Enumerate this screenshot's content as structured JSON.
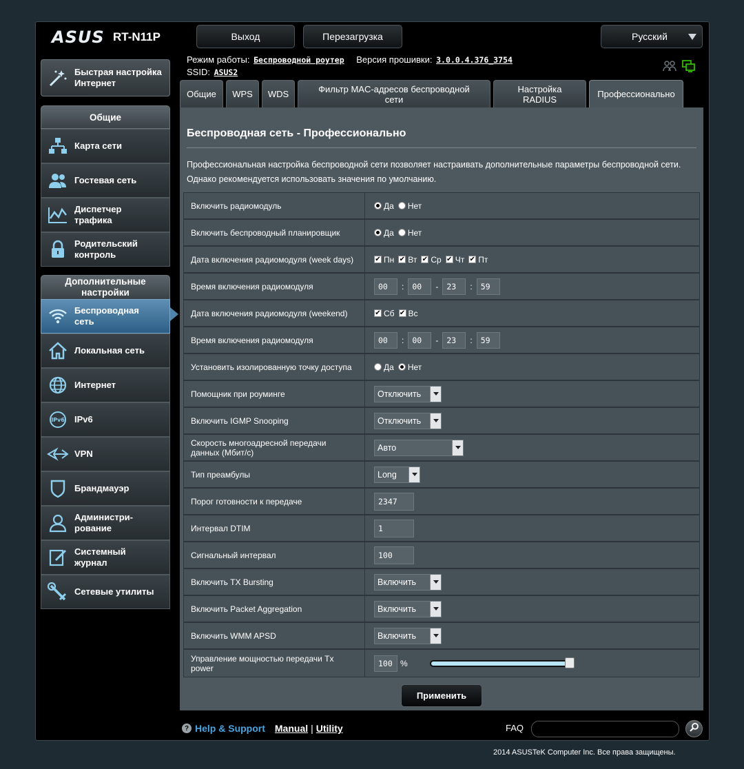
{
  "header": {
    "logo_text": "ASUS",
    "model": "RT-N11P",
    "logout_label": "Выход",
    "reboot_label": "Перезагрузка",
    "language": "Русский"
  },
  "info": {
    "mode_label": "Режим работы:",
    "mode_value": "Беспроводной роутер",
    "firmware_label": "Версия прошивки:",
    "firmware_value": "3.0.0.4.376_3754",
    "ssid_label": "SSID:",
    "ssid_value": "ASUS2"
  },
  "sidebar": {
    "quick_setup": [
      "Быстрая настройка",
      "Интернет"
    ],
    "general_header": "Общие",
    "general_items": [
      {
        "label": "Карта сети"
      },
      {
        "label": "Гостевая сеть"
      },
      {
        "label1": "Диспетчер",
        "label2": "трафика"
      },
      {
        "label1": "Родительский",
        "label2": "контроль"
      }
    ],
    "advanced_header1": "Дополнительные",
    "advanced_header2": "настройки",
    "advanced_items": [
      {
        "label1": "Беспроводная",
        "label2": "сеть"
      },
      {
        "label": "Локальная сеть"
      },
      {
        "label": "Интернет"
      },
      {
        "label": "IPv6"
      },
      {
        "label": "VPN"
      },
      {
        "label": "Брандмауэр"
      },
      {
        "label1": "Администри-",
        "label2": "рование"
      },
      {
        "label1": "Системный",
        "label2": "журнал"
      },
      {
        "label": "Сетевые утилиты"
      }
    ]
  },
  "tabs": {
    "general": "Общие",
    "wps": "WPS",
    "wds": "WDS",
    "mac_filter": "Фильтр MAC-адресов беспроводной сети",
    "radius1": "Настройка",
    "radius2": "RADIUS",
    "professional": "Профессионально"
  },
  "page": {
    "title": "Беспроводная сеть - Профессионально",
    "desc1": "Профессиональная настройка беспроводной сети позволяет настраивать дополнительные параметры беспроводной сети.",
    "desc2": "Однако рекомендуется использовать значения по умолчанию."
  },
  "labels": {
    "yes": "Да",
    "no": "Нет"
  },
  "form": {
    "enable_radio": {
      "label": "Включить радиомодуль",
      "value": "Да"
    },
    "enable_scheduler": {
      "label": "Включить беспроводный планировщик",
      "value": "Да"
    },
    "weekdays": {
      "label": "Дата включения радиомодуля (week days)",
      "days": [
        "Пн",
        "Вт",
        "Ср",
        "Чт",
        "Пт"
      ]
    },
    "weekday_time": {
      "label": "Время включения радиомодуля",
      "h1": "00",
      "m1": "00",
      "h2": "23",
      "m2": "59"
    },
    "weekend": {
      "label": "Дата включения радиомодуля (weekend)",
      "days": [
        "Сб",
        "Вс"
      ]
    },
    "weekend_time": {
      "label": "Время включения радиомодуля",
      "h1": "00",
      "m1": "00",
      "h2": "23",
      "m2": "59"
    },
    "ap_isolated": {
      "label": "Установить изолированную точку доступа",
      "value": "Нет"
    },
    "roaming": {
      "label": "Помощник при роуминге",
      "value": "Отключить"
    },
    "igmp": {
      "label": "Включить IGMP Snooping",
      "value": "Отключить"
    },
    "multicast": {
      "label1": "Скорость многоадресной передачи",
      "label2": "данных (Мбит/с)",
      "value": "Авто"
    },
    "preamble": {
      "label": "Тип преамбулы",
      "value": "Long"
    },
    "rts": {
      "label": "Порог готовности к передаче",
      "value": "2347"
    },
    "dtim": {
      "label": "Интервал DTIM",
      "value": "1"
    },
    "beacon": {
      "label": "Сигнальный интервал",
      "value": "100"
    },
    "tx_bursting": {
      "label": "Включить TX Bursting",
      "value": "Включить"
    },
    "pkt_agg": {
      "label": "Включить Packet Aggregation",
      "value": "Включить"
    },
    "wmm_apsd": {
      "label": "Включить WMM APSD",
      "value": "Включить"
    },
    "tx_power": {
      "label1": "Управление мощностью передачи Tx",
      "label2": "power",
      "value": "100",
      "unit": "%",
      "level": 1.0
    }
  },
  "apply_label": "Применить",
  "footer": {
    "help": "Help & Support",
    "manual": "Manual",
    "separator": "|",
    "utility": "Utility",
    "faq": "FAQ",
    "copyright": "2014 ASUSTeK Computer Inc. Все права защищены."
  }
}
